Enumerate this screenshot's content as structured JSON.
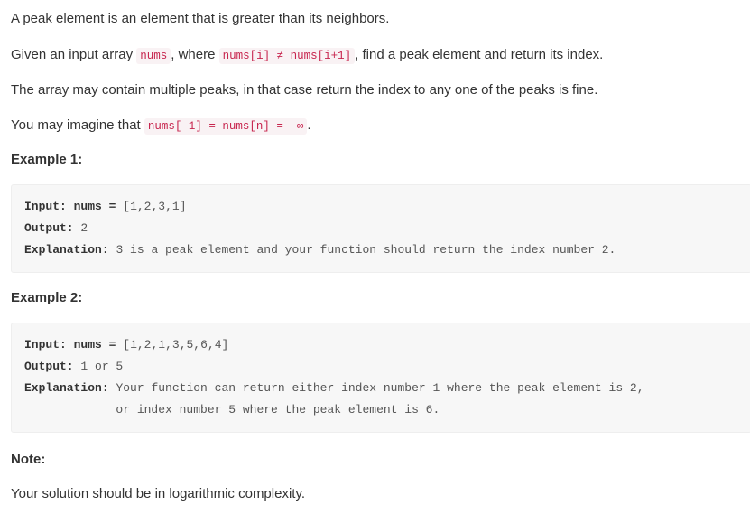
{
  "description": {
    "paragraphs": [
      {
        "id": "p1",
        "segments": [
          {
            "type": "text",
            "value": "A peak element is an element that is greater than its neighbors."
          }
        ]
      },
      {
        "id": "p2",
        "segments": [
          {
            "type": "text",
            "value": "Given an input array "
          },
          {
            "type": "code",
            "value": "nums"
          },
          {
            "type": "text",
            "value": ", where "
          },
          {
            "type": "code",
            "value": "nums[i] ≠ nums[i+1]"
          },
          {
            "type": "text",
            "value": ", find a peak element and return its index."
          }
        ]
      },
      {
        "id": "p3",
        "segments": [
          {
            "type": "text",
            "value": "The array may contain multiple peaks, in that case return the index to any one of the peaks is fine."
          }
        ]
      },
      {
        "id": "p4",
        "segments": [
          {
            "type": "text",
            "value": "You may imagine that "
          },
          {
            "type": "code",
            "value": "nums[-1] = nums[n] = -∞"
          },
          {
            "type": "text",
            "value": "."
          }
        ]
      }
    ],
    "p1_text": "A peak element is an element that is greater than its neighbors.",
    "p2_prefix": "Given an input array",
    "p2_code1": "nums",
    "p2_mid": ", where",
    "p2_code2": "nums[i] ≠ nums[i+1]",
    "p2_suffix": ", find a peak element and return its index.",
    "p3_text": "The array may contain multiple peaks, in that case return the index to any one of the peaks is fine.",
    "p4_prefix": "You may imagine that",
    "p4_code": "nums[-1] = nums[n] = -∞",
    "p4_suffix": "."
  },
  "example1": {
    "title": "Example 1:",
    "input_label": "Input:",
    "input_var": "nums",
    "input_eq": "=",
    "input_value": "[1,2,3,1]",
    "output_label": "Output:",
    "output_value": "2",
    "explanation_label": "Explanation:",
    "explanation_value": "3 is a peak element and your function should return the index number 2."
  },
  "example2": {
    "title": "Example 2:",
    "input_label": "Input:",
    "input_var": "nums",
    "input_eq": "=",
    "input_value": "[1,2,1,3,5,6,4]",
    "output_label": "Output:",
    "output_value": "1 or 5",
    "explanation_label": "Explanation:",
    "explanation_line1": "Your function can return either index number 1 where the peak element is 2,",
    "explanation_line2": "or index number 5 where the peak element is 6."
  },
  "note": {
    "title": "Note:",
    "body": "Your solution should be in logarithmic complexity."
  },
  "colors": {
    "body_text": "#333333",
    "inline_code_text": "#c7254e",
    "inline_code_bg": "#f9f2f4",
    "codeblock_bg": "#f7f7f7",
    "codeblock_border": "#eeeeee",
    "codeblock_text": "#555555",
    "page_bg": "#ffffff"
  }
}
